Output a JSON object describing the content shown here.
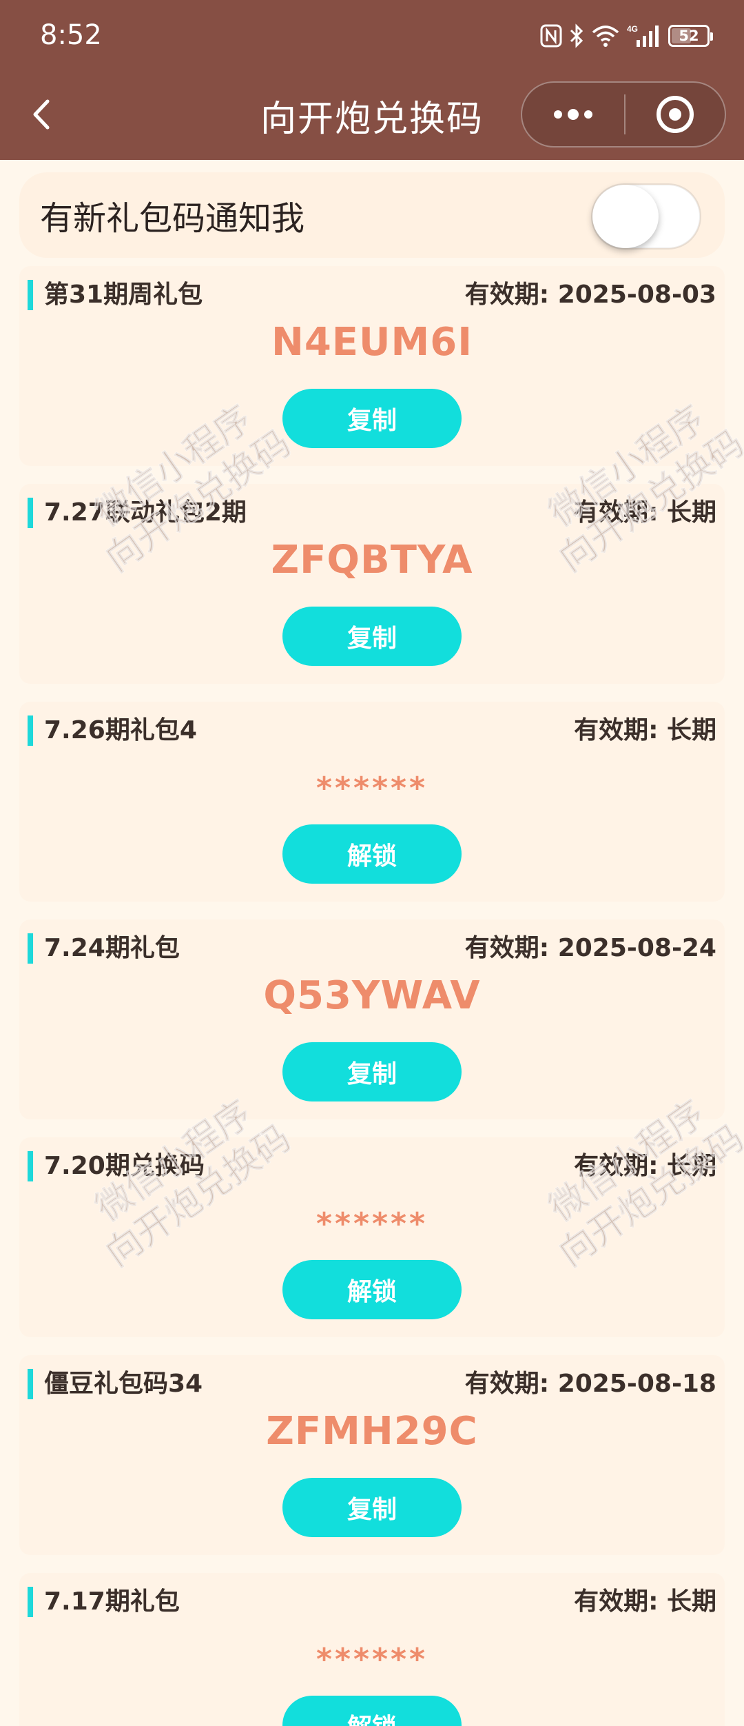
{
  "status_bar": {
    "time": "8:52",
    "battery": "52",
    "icons": [
      "nfc-icon",
      "bluetooth-icon",
      "wifi-icon",
      "signal-4g-icon",
      "battery-icon"
    ]
  },
  "nav": {
    "title": "向开炮兑换码"
  },
  "notify": {
    "label": "有新礼包码通知我",
    "enabled": false
  },
  "cards": [
    {
      "title": "第31期周礼包",
      "expiry": "有效期: 2025-08-03",
      "code": "N4EUM6I",
      "button": "复制"
    },
    {
      "title": "7.27联动礼包2期",
      "expiry": "有效期: 长期",
      "code": "ZFQBTYA",
      "button": "复制"
    },
    {
      "title": "7.26期礼包4",
      "expiry": "有效期: 长期",
      "code": "******",
      "button": "解锁"
    },
    {
      "title": "7.24期礼包",
      "expiry": "有效期: 2025-08-24",
      "code": "Q53YWAV",
      "button": "复制"
    },
    {
      "title": "7.20期兑换码",
      "expiry": "有效期: 长期",
      "code": "******",
      "button": "解锁"
    },
    {
      "title": "僵豆礼包码34",
      "expiry": "有效期: 2025-08-18",
      "code": "ZFMH29C",
      "button": "复制"
    },
    {
      "title": "7.17期礼包",
      "expiry": "有效期: 长期",
      "code": "******",
      "button": "解锁"
    }
  ],
  "watermark": {
    "line1": "微信小程序",
    "line2": "向开炮兑换码"
  },
  "colors": {
    "header": "#864F44",
    "background": "#FFF7EC",
    "card": "#FFF3E6",
    "accent": "#12DEDC",
    "code": "#EE8C6B"
  }
}
